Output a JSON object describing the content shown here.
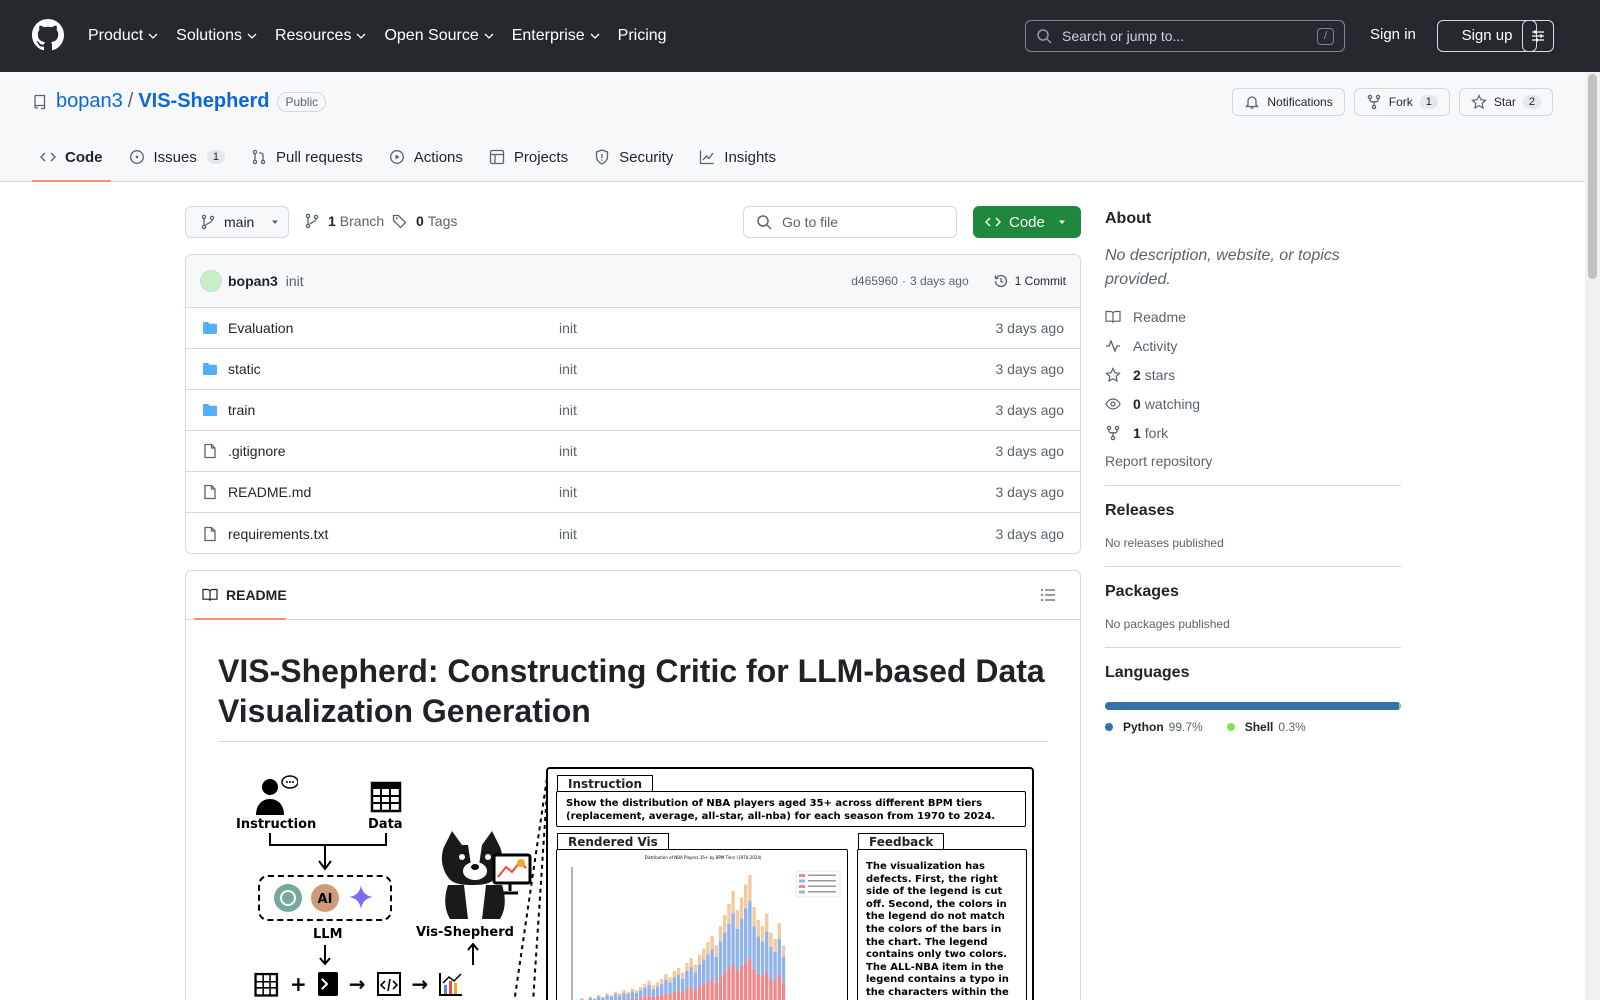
{
  "header": {
    "nav": [
      "Product",
      "Solutions",
      "Resources",
      "Open Source",
      "Enterprise",
      "Pricing"
    ],
    "search_placeholder": "Search or jump to...",
    "search_shortcut": "/",
    "sign_in": "Sign in",
    "sign_up": "Sign up"
  },
  "repo": {
    "owner": "bopan3",
    "separator": "/",
    "name": "VIS-Shepherd",
    "visibility": "Public",
    "notifications_label": "Notifications",
    "fork_label": "Fork",
    "fork_count": "1",
    "star_label": "Star",
    "star_count": "2",
    "tabs": [
      {
        "label": "Code",
        "count": ""
      },
      {
        "label": "Issues",
        "count": "1"
      },
      {
        "label": "Pull requests",
        "count": ""
      },
      {
        "label": "Actions",
        "count": ""
      },
      {
        "label": "Projects",
        "count": ""
      },
      {
        "label": "Security",
        "count": ""
      },
      {
        "label": "Insights",
        "count": ""
      }
    ]
  },
  "toolbar": {
    "branch": "main",
    "branch_count": "1",
    "branch_label": "Branch",
    "tag_count": "0",
    "tag_label": "Tags",
    "goto_placeholder": "Go to file",
    "code_label": "Code"
  },
  "commit": {
    "author": "bopan3",
    "message": "init",
    "hash": "d465960",
    "dot": "·",
    "age": "3 days ago",
    "commits": "1 Commit"
  },
  "files": [
    {
      "name": "Evaluation",
      "type": "folder",
      "message": "init",
      "time": "3 days ago"
    },
    {
      "name": "static",
      "type": "folder",
      "message": "init",
      "time": "3 days ago"
    },
    {
      "name": "train",
      "type": "folder",
      "message": "init",
      "time": "3 days ago"
    },
    {
      "name": ".gitignore",
      "type": "file",
      "message": "init",
      "time": "3 days ago"
    },
    {
      "name": "README.md",
      "type": "file",
      "message": "init",
      "time": "3 days ago"
    },
    {
      "name": "requirements.txt",
      "type": "file",
      "message": "init",
      "time": "3 days ago"
    }
  ],
  "readme": {
    "tab_label": "README",
    "title": "VIS-Shepherd: Constructing Critic for LLM-based Data Visualization Generation",
    "figure": {
      "instruction_label": "Instruction",
      "data_label": "Data",
      "llm_label": "LLM",
      "shepherd_label": "Vis-Shepherd",
      "instruction_tab": "Instruction",
      "instruction_text": "Show the distribution of NBA players aged 35+ across different BPM tiers (replacement, average, all-star, all-nba) for each season from 1970 to 2024.",
      "rendered_tab": "Rendered Vis",
      "rendered_chart_title": "Distribution of NBA Players 35+ by BPM Tiers (1970-2024)",
      "feedback_tab": "Feedback",
      "feedback_text": "The visualization has defects. First, the right side of the legend is cut off. Second, the colors in the legend do not match the colors of the bars in the chart. The legend contains only two colors. The ALL-NBA item in the legend contains a typo in the characters within the parentheses."
    }
  },
  "sidebar": {
    "about_title": "About",
    "about_desc": "No description, website, or topics provided.",
    "readme": "Readme",
    "activity": "Activity",
    "stars_count": "2",
    "stars_label": "stars",
    "watching_count": "0",
    "watching_label": "watching",
    "fork_count": "1",
    "fork_label": "fork",
    "report": "Report repository",
    "releases_title": "Releases",
    "releases_text": "No releases published",
    "packages_title": "Packages",
    "packages_text": "No packages published",
    "languages_title": "Languages",
    "languages": [
      {
        "name": "Python",
        "percent": "99.7%",
        "color": "#3572a5"
      },
      {
        "name": "Shell",
        "percent": "0.3%",
        "color": "#89e051"
      }
    ]
  },
  "colors": {
    "header_bg": "#25292e",
    "link": "#0969da",
    "code_button": "#1f883d",
    "tab_underline": "#fd8c73"
  }
}
